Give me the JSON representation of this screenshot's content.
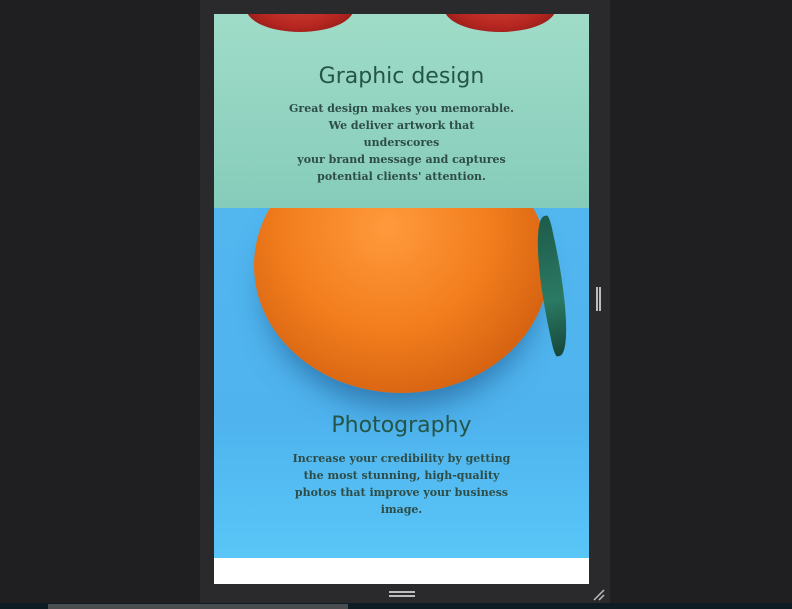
{
  "sections": {
    "graphic": {
      "title": "Graphic design",
      "lines": [
        "Great design makes you memorable.",
        "We deliver artwork that underscores",
        "your brand message and captures",
        "potential clients' attention."
      ]
    },
    "photo": {
      "title": "Photography",
      "lines": [
        "Increase your credibility by getting",
        "the most stunning, high-quality",
        "photos that improve your business",
        "image."
      ]
    }
  },
  "icons": {
    "resize_right": "resize-handle-icon",
    "resize_bottom": "resize-handle-icon",
    "resize_corner": "resize-corner-icon"
  }
}
